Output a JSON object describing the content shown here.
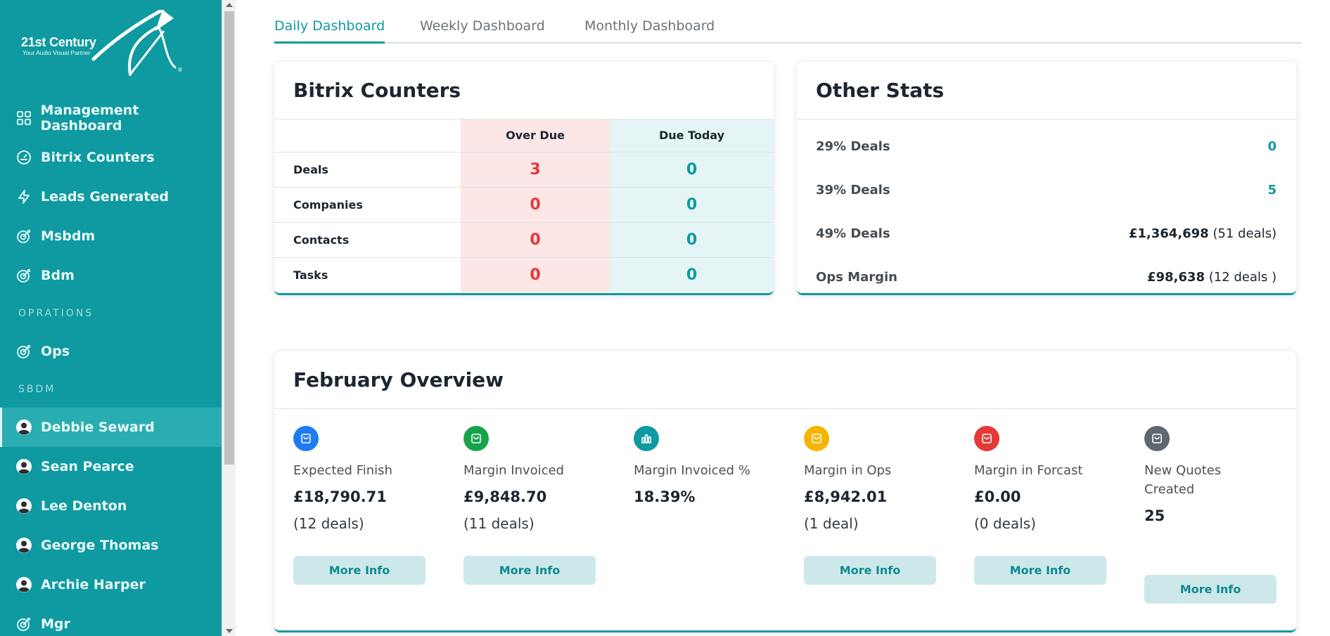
{
  "logo": {
    "brand": "21st Century",
    "tagline": "Your Audio Visual Partner",
    "mark": "®"
  },
  "sidebar": {
    "items": [
      {
        "label": "Management Dashboard",
        "icon": "grid-icon"
      },
      {
        "label": "Bitrix Counters",
        "icon": "gauge-icon"
      },
      {
        "label": "Leads Generated",
        "icon": "bolt-icon"
      },
      {
        "label": "Msbdm",
        "icon": "target-icon"
      },
      {
        "label": "Bdm",
        "icon": "target-icon"
      }
    ],
    "section_operations": "OPRATIONS",
    "ops_items": [
      {
        "label": "Ops",
        "icon": "target-icon"
      }
    ],
    "section_sbdm": "SBDM",
    "sbdm_items": [
      {
        "label": "Debbie Seward",
        "icon": "user-icon",
        "active": true
      },
      {
        "label": "Sean Pearce",
        "icon": "user-icon"
      },
      {
        "label": "Lee Denton",
        "icon": "user-icon"
      },
      {
        "label": "George Thomas",
        "icon": "user-icon"
      },
      {
        "label": "Archie Harper",
        "icon": "user-icon"
      },
      {
        "label": "Mgr",
        "icon": "target-icon"
      }
    ]
  },
  "tabs": [
    {
      "label": "Daily Dashboard",
      "active": true
    },
    {
      "label": "Weekly Dashboard"
    },
    {
      "label": "Monthly Dashboard"
    }
  ],
  "bitrix": {
    "title": "Bitrix Counters",
    "col_overdue": "Over Due",
    "col_duetoday": "Due Today",
    "rows": [
      {
        "label": "Deals",
        "overdue": "3",
        "duetoday": "0"
      },
      {
        "label": "Companies",
        "overdue": "0",
        "duetoday": "0"
      },
      {
        "label": "Contacts",
        "overdue": "0",
        "duetoday": "0"
      },
      {
        "label": "Tasks",
        "overdue": "0",
        "duetoday": "0"
      }
    ]
  },
  "stats": {
    "title": "Other Stats",
    "rows": [
      {
        "label": "29% Deals",
        "value": "0"
      },
      {
        "label": "39% Deals",
        "value": "5"
      },
      {
        "label": "49% Deals",
        "amount": "£1,364,698",
        "deals": " (51 deals)"
      },
      {
        "label": "Ops Margin",
        "amount": "£98,638",
        "deals": " (12 deals )"
      }
    ]
  },
  "february": {
    "title": "February Overview",
    "button_label": "More Info",
    "metrics": [
      {
        "label": "Expected Finish",
        "value": "£18,790.71",
        "deals": "(12 deals)",
        "color": "#1e7cf2"
      },
      {
        "label": "Margin Invoiced",
        "value": "£9,848.70",
        "deals": "(11 deals)",
        "color": "#17a34a"
      },
      {
        "label": "Margin Invoiced %",
        "value": "18.39%",
        "deals": "",
        "color": "#0e9aa0"
      },
      {
        "label": "Margin in Ops",
        "value": "£8,942.01",
        "deals": "(1 deal)",
        "color": "#f5b400"
      },
      {
        "label": "Margin in Forcast",
        "value": "£0.00",
        "deals": "(0 deals)",
        "color": "#e53935"
      },
      {
        "label": "New Quotes Created",
        "value": "25",
        "deals": "",
        "color": "#5f6770"
      }
    ]
  }
}
